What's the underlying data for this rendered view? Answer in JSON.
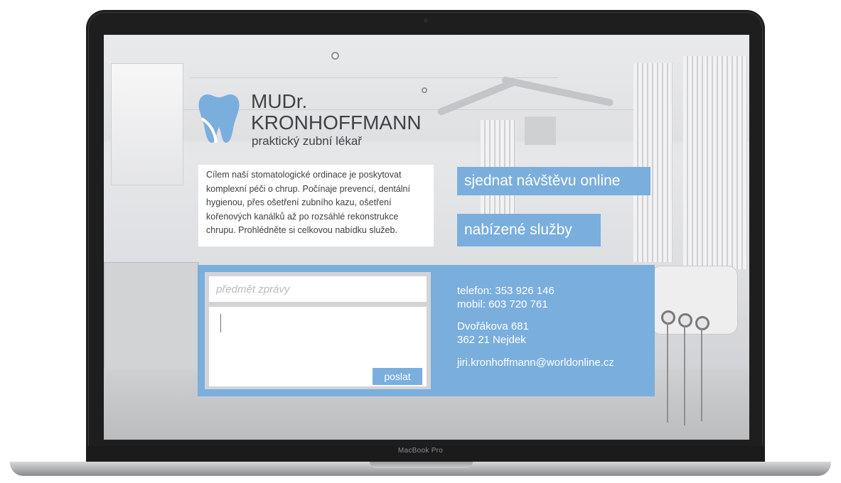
{
  "device": {
    "model_label": "MacBook Pro"
  },
  "brand": {
    "name_line1": "MUDr.",
    "name_line2": "KRONHOFFMANN",
    "subtitle": "praktický zubní lékař",
    "logo_icon": "tooth-icon"
  },
  "intro": {
    "lines": [
      "Cílem naší stomatologické ordinace je poskytovat",
      "komplexní péči o chrup. Počínaje prevencí, dentální",
      "hygienou, přes ošetření zubního kazu, ošetření",
      "kořenových kanálků až po rozsáhlé rekonstrukce",
      "chrupu. Prohlédněte si celkovou nabídku služeb."
    ]
  },
  "actions": {
    "book_online": "sjednat návštěvu online",
    "services": "nabízené služby"
  },
  "contact_form": {
    "subject_placeholder": "předmět zprávy",
    "subject_value": "",
    "message_value": "",
    "send_label": "poslat"
  },
  "contact_info": {
    "phone": "telefon: 353 926 146",
    "mobile": "mobil: 603 720 761",
    "street": "Dvořákova 681",
    "city": "362 21 Nejdek",
    "email": "jiri.kronhoffmann@worldonline.cz"
  },
  "colors": {
    "accent": "#7aaedd",
    "text_dark": "#414245",
    "bezel": "#1e1e1f"
  }
}
